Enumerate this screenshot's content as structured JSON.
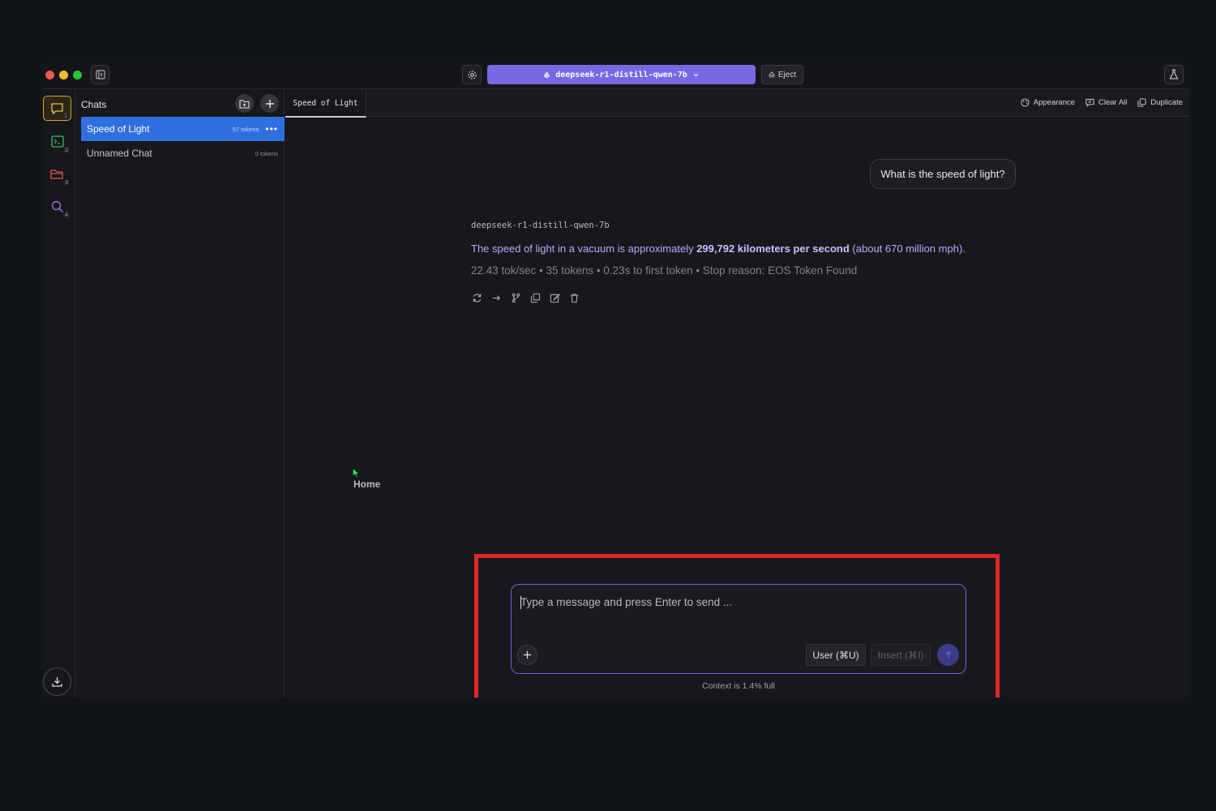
{
  "titlebar": {
    "model_selector": "deepseek-r1-distill-qwen-7b",
    "eject_label": "Eject"
  },
  "rail": {
    "items": [
      {
        "icon": "chat-icon",
        "badge": "1"
      },
      {
        "icon": "terminal-icon",
        "badge": "2"
      },
      {
        "icon": "folder-icon",
        "badge": "3"
      },
      {
        "icon": "search-icon",
        "badge": "4"
      }
    ]
  },
  "sidebar": {
    "title": "Chats",
    "chats": [
      {
        "name": "Speed of Light",
        "tokens": "57 tokens"
      },
      {
        "name": "Unnamed Chat",
        "tokens": "0 tokens"
      }
    ]
  },
  "tabbar": {
    "active_tab": "Speed of Light",
    "actions": {
      "appearance": "Appearance",
      "clear_all": "Clear All",
      "duplicate": "Duplicate"
    }
  },
  "conversation": {
    "user_message": "What is the speed of light?",
    "model_name": "deepseek-r1-distill-qwen-7b",
    "reply_prefix": "The speed of light in a vacuum is approximately ",
    "reply_bold": "299,792 kilometers per second",
    "reply_suffix": " (about 670 million mph).",
    "stats": "22.43 tok/sec • 35 tokens • 0.23s to first token • Stop reason: EOS Token Found"
  },
  "overlay": {
    "home_label": "Home"
  },
  "composer": {
    "placeholder": "Type a message and press Enter to send ...",
    "user_label": "User (⌘U)",
    "insert_label": "Insert (⌘I)",
    "context_note": "Context is 1.4% full"
  },
  "colors": {
    "accent": "#7868e6",
    "selected_chat": "#2f6fe0",
    "highlight_box": "#e1262a"
  }
}
